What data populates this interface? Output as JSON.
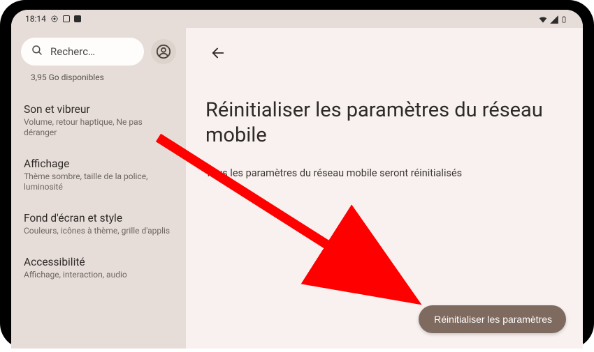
{
  "status": {
    "time": "18:14"
  },
  "sidebar": {
    "search_placeholder": "Recherc…",
    "storage_line": "3,95 Go disponibles",
    "items": [
      {
        "title": "Son et vibreur",
        "sub": "Volume, retour haptique, Ne pas déranger"
      },
      {
        "title": "Affichage",
        "sub": "Thème sombre, taille de la police, luminosité"
      },
      {
        "title": "Fond d'écran et style",
        "sub": "Couleurs, icônes à thème, grille d'applis"
      },
      {
        "title": "Accessibilité",
        "sub": "Affichage, interaction, audio"
      }
    ]
  },
  "main": {
    "title": "Réinitialiser les paramètres du réseau mobile",
    "description": "Tous les paramètres du réseau mobile seront réinitialisés",
    "action_label": "Réinitialiser les paramètres"
  },
  "colors": {
    "accent_button": "#7f6a5f",
    "sidebar_bg": "#e6ddd8",
    "main_bg": "#f8f1ef",
    "annotation_arrow": "#ff0000"
  }
}
